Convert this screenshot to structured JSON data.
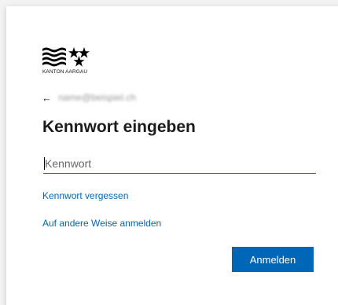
{
  "branding": {
    "logo_text": "KANTON AARGAU"
  },
  "identity": {
    "back_icon": "←",
    "email": "name@beispiel.ch"
  },
  "title": "Kennwort eingeben",
  "password_field": {
    "placeholder": "Kennwort",
    "value": ""
  },
  "links": {
    "forgot": "Kennwort vergessen",
    "other_method": "Auf andere Weise anmelden"
  },
  "buttons": {
    "sign_in": "Anmelden"
  },
  "colors": {
    "accent": "#0067b8",
    "background": "#f2f2f2",
    "card": "#ffffff"
  }
}
